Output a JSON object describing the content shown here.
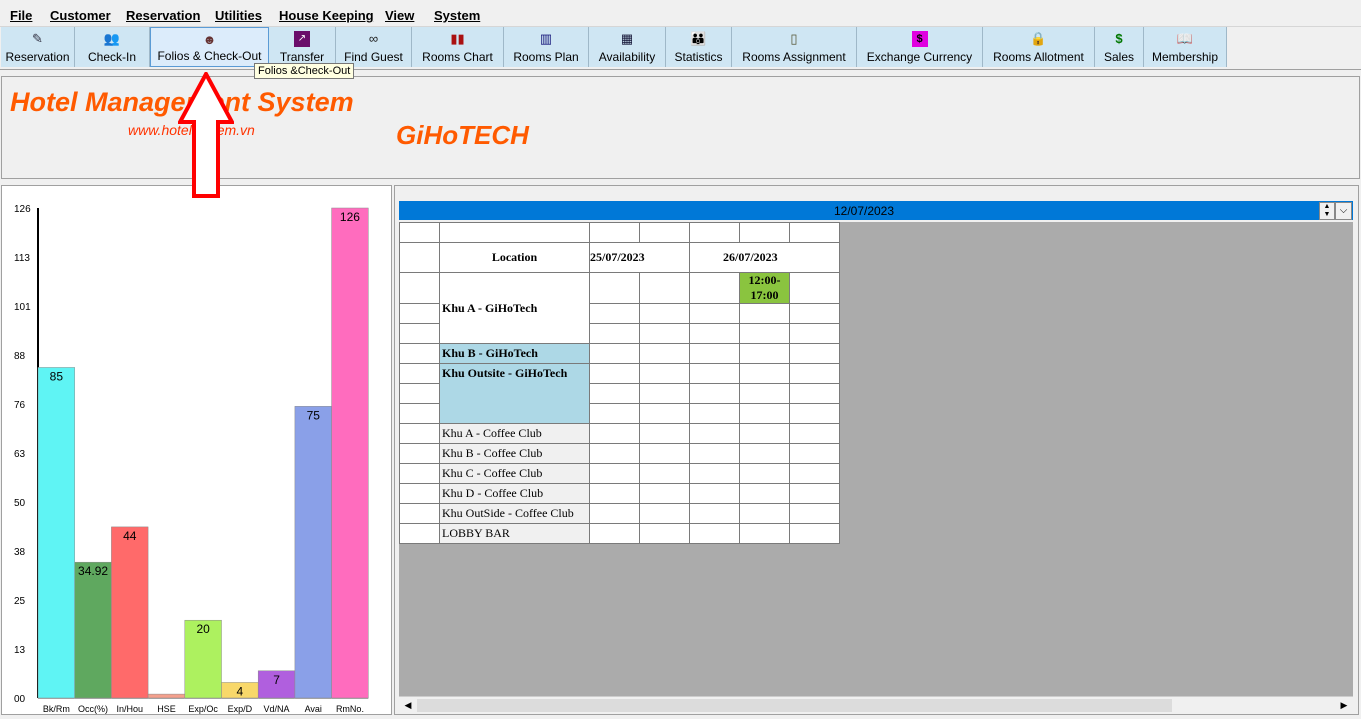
{
  "menu": [
    "File",
    "Customer",
    "Reservation",
    "Utilities",
    "House Keeping",
    "View",
    "System"
  ],
  "toolbar": [
    {
      "label": "Reservation",
      "icon": "pen-icon"
    },
    {
      "label": "Check-In",
      "icon": "people-icon"
    },
    {
      "label": "Folios & Check-Out",
      "icon": "person-icon"
    },
    {
      "label": "Transfer",
      "icon": "trend-chart-icon"
    },
    {
      "label": "Find Guest",
      "icon": "binoculars-icon"
    },
    {
      "label": "Rooms Chart",
      "icon": "bar-chart-icon"
    },
    {
      "label": "Rooms Plan",
      "icon": "books-icon"
    },
    {
      "label": "Availability",
      "icon": "building-icon"
    },
    {
      "label": "Statistics",
      "icon": "group-icon"
    },
    {
      "label": "Rooms Assignment",
      "icon": "door-icon"
    },
    {
      "label": "Exchange Currency",
      "icon": "dollar-icon"
    },
    {
      "label": "Rooms Allotment",
      "icon": "lock-icon"
    },
    {
      "label": "Sales",
      "icon": "money-icon"
    },
    {
      "label": "Membership",
      "icon": "book-icon"
    }
  ],
  "tooltip": "Folios &Check-Out",
  "header": {
    "title": "Hotel Management System",
    "url": "www.hotelsystem.vn",
    "brand": "GiHoTECH"
  },
  "chart_data": {
    "type": "bar",
    "categories": [
      "Bk/Rm",
      "Occ(%)",
      "In/Hou",
      "HSE",
      "Exp/Oc",
      "Exp/D",
      "Vd/NA",
      "Avai",
      "RmNo."
    ],
    "values": [
      85,
      34.92,
      44,
      1,
      20,
      4,
      7,
      75,
      126
    ],
    "value_labels": [
      "85",
      "34.92",
      "44",
      "",
      "20",
      "4",
      "7",
      "75",
      "126"
    ],
    "colors": [
      "#5ff4f4",
      "#5fa85f",
      "#ff6a6a",
      "#f4a08c",
      "#adf15f",
      "#f8d86a",
      "#b05fde",
      "#8aa0e8",
      "#ff6cbe"
    ],
    "y_ticks": [
      "00",
      "13",
      "25",
      "38",
      "50",
      "63",
      "76",
      "88",
      "101",
      "113",
      "126"
    ],
    "ylim": [
      0,
      126
    ]
  },
  "schedule": {
    "selected_date": "12/07/2023",
    "location_header": "Location",
    "date_headers": [
      "25/07/2023",
      "26/07/2023"
    ],
    "zones": [
      {
        "name": "Khu A - GiHoTech"
      },
      {
        "name": "Khu B - GiHoTech"
      },
      {
        "name": "Khu Outsite - GiHoTech"
      }
    ],
    "outlets": [
      "Khu A - Coffee Club",
      "Khu B - Coffee Club",
      "Khu C - Coffee Club",
      "Khu D - Coffee Club",
      "Khu OutSide - Coffee Club",
      "LOBBY BAR"
    ],
    "booking": "12:00-17:00"
  }
}
